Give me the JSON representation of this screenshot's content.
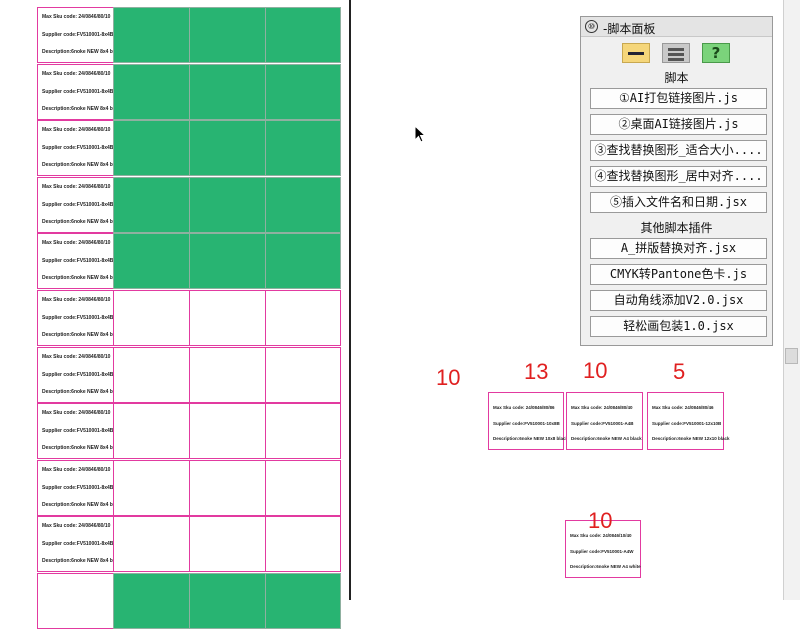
{
  "grid_rows": [
    {
      "code": "Max Sku code: 24/0846/80/10",
      "supplier": "Supplier code:FV510001-8x4B",
      "desc": "Description:6noke NEW 8x4 black",
      "filled": true
    },
    {
      "code": "Max Sku code: 24/0846/80/10",
      "supplier": "Supplier code:FV510001-8x4B",
      "desc": "Description:6noke NEW 8x4 black",
      "filled": true
    },
    {
      "code": "Max Sku code: 24/0846/80/10",
      "supplier": "Supplier code:FV510001-8x4B",
      "desc": "Description:6noke NEW 8x4 black",
      "filled": true
    },
    {
      "code": "Max Sku code: 24/0846/80/10",
      "supplier": "Supplier code:FV510001-8x4B",
      "desc": "Description:6noke NEW 8x4 black",
      "filled": true
    },
    {
      "code": "Max Sku code: 24/0846/80/10",
      "supplier": "Supplier code:FV510001-8x4B",
      "desc": "Description:6noke NEW 8x4 black",
      "filled": true
    },
    {
      "code": "Max Sku code: 24/0846/80/10",
      "supplier": "Supplier code:FV510001-8x4B",
      "desc": "Description:6noke NEW 8x4 black",
      "filled": false
    },
    {
      "code": "Max Sku code: 24/0846/80/10",
      "supplier": "Supplier code:FV510001-8x4B",
      "desc": "Description:6noke NEW 8x4 black",
      "filled": false
    },
    {
      "code": "Max Sku code: 24/0846/80/10",
      "supplier": "Supplier code:FV510001-8x4B",
      "desc": "Description:6noke NEW 8x4 black",
      "filled": false
    },
    {
      "code": "Max Sku code: 24/0846/80/10",
      "supplier": "Supplier code:FV510001-8x4B",
      "desc": "Description:6noke NEW 8x4 black",
      "filled": false
    },
    {
      "code": "Max Sku code: 24/0846/80/10",
      "supplier": "Supplier code:FV510001-8x4B",
      "desc": "Description:6noke NEW 8x4 black",
      "filled": false
    },
    {
      "code": "",
      "supplier": "",
      "desc": "",
      "filled": true
    }
  ],
  "labels": [
    {
      "code": "Max Sku code: 24/0846/80/86",
      "supplier": "Supplier code:FV510001-10x8B",
      "desc": "Description:6noke NEW 10x8 black"
    },
    {
      "code": "Max Sku code: 24/0846/80/40",
      "supplier": "Supplier code:FV510001-A4B",
      "desc": "Description:6noke NEW A4 black"
    },
    {
      "code": "Max Sku code: 24/0846/80/46",
      "supplier": "Supplier code:FV510001-12x10B",
      "desc": "Description:6noke NEW 12x10 black"
    },
    {
      "code": "Max Sku code: 24/0846/10/40",
      "supplier": "Supplier code:FV510001-A4W",
      "desc": "Description:6noke NEW A4 white"
    }
  ],
  "numbers": [
    "10",
    "13",
    "10",
    "5",
    "10"
  ],
  "panel": {
    "title": "脚本面板",
    "title_icon": "⑩",
    "section1": "脚本",
    "scripts": [
      "①AI打包链接图片.js",
      "②桌面AI链接图片.js",
      "③查找替换图形_适合大小....",
      "④查找替换图形_居中对齐....",
      "⑤插入文件名和日期.jsx"
    ],
    "section2": "其他脚本插件",
    "plugins": [
      "A_拼版替换对齐.jsx",
      "CMYK转Pantone色卡.js",
      "自动角线添加V2.0.jsx",
      "轻松画包装1.0.jsx"
    ]
  },
  "colors": {
    "green_fill": "#28b472",
    "cell_border": "#e23aa0",
    "number_red": "#e02020"
  }
}
